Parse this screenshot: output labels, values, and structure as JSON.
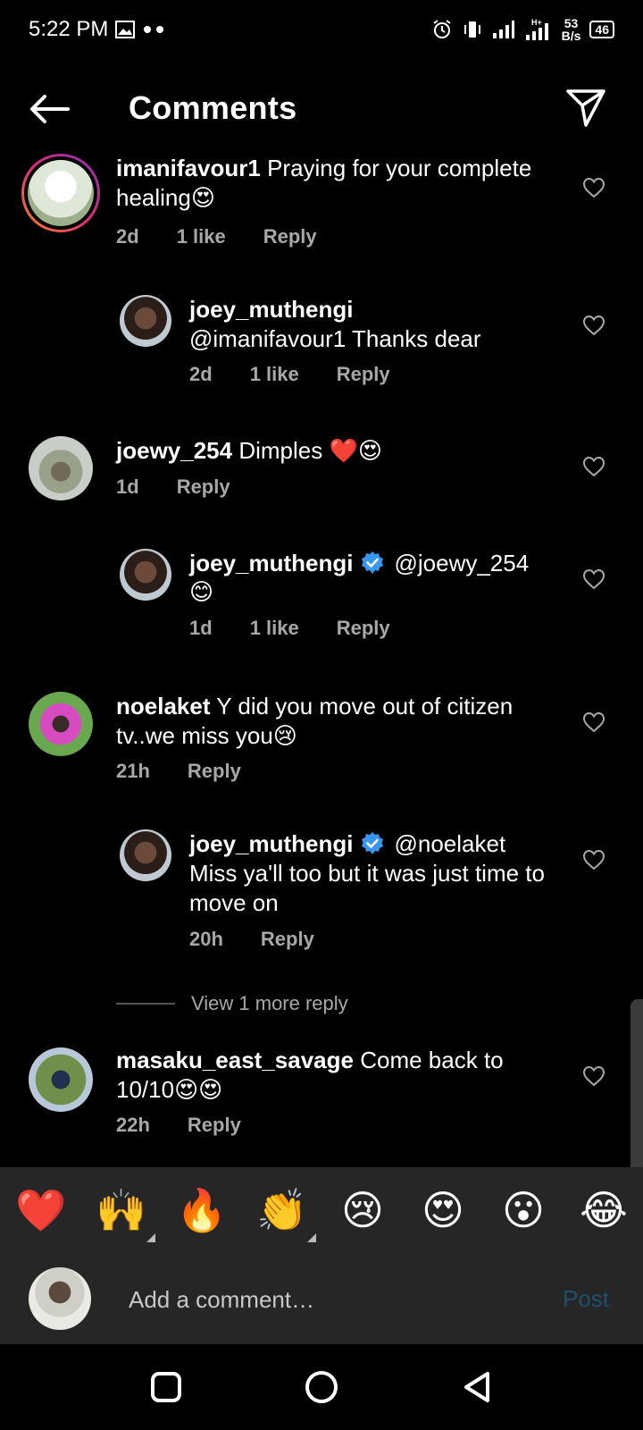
{
  "status_bar": {
    "time": "5:22 PM",
    "speed_value": "53",
    "speed_unit": "B/s",
    "battery": "46",
    "network": "H+"
  },
  "header": {
    "title": "Comments"
  },
  "comments": [
    {
      "username": "imanifavour1",
      "text": "Praying for your complete healing😍",
      "time": "2d",
      "likes": "1 like",
      "reply_label": "Reply"
    },
    {
      "username": "joey_muthengi",
      "text": "@imanifavour1 Thanks dear",
      "time": "2d",
      "likes": "1 like",
      "reply_label": "Reply"
    },
    {
      "username": "joewy_254",
      "text": "Dimples ❤️😍",
      "time": "1d",
      "reply_label": "Reply"
    },
    {
      "username": "joey_muthengi",
      "mention": "@joewy_254",
      "text": "😊",
      "time": "1d",
      "likes": "1 like",
      "reply_label": "Reply"
    },
    {
      "username": "noelaket",
      "text": "Y did you move out of citizen tv..we miss you😢",
      "time": "21h",
      "reply_label": "Reply"
    },
    {
      "username": "joey_muthengi",
      "mention": "@noelaket",
      "text": "Miss ya'll too but it was just time to move on",
      "time": "20h",
      "reply_label": "Reply"
    },
    {
      "username": "masaku_east_savage",
      "text": "Come back to 10/10😍😍",
      "time": "22h",
      "reply_label": "Reply"
    }
  ],
  "view_more": "View 1 more reply",
  "reactions": [
    "❤️",
    "🙌",
    "🔥",
    "👏",
    "😢",
    "😍",
    "😮",
    "😂"
  ],
  "composer": {
    "placeholder": "Add a comment…",
    "post_label": "Post"
  },
  "colors": {
    "background": "#000000",
    "secondary_text": "#a8a8a8",
    "panel": "#262626",
    "post_disabled": "#1f4f6f",
    "verified": "#3897f0"
  }
}
